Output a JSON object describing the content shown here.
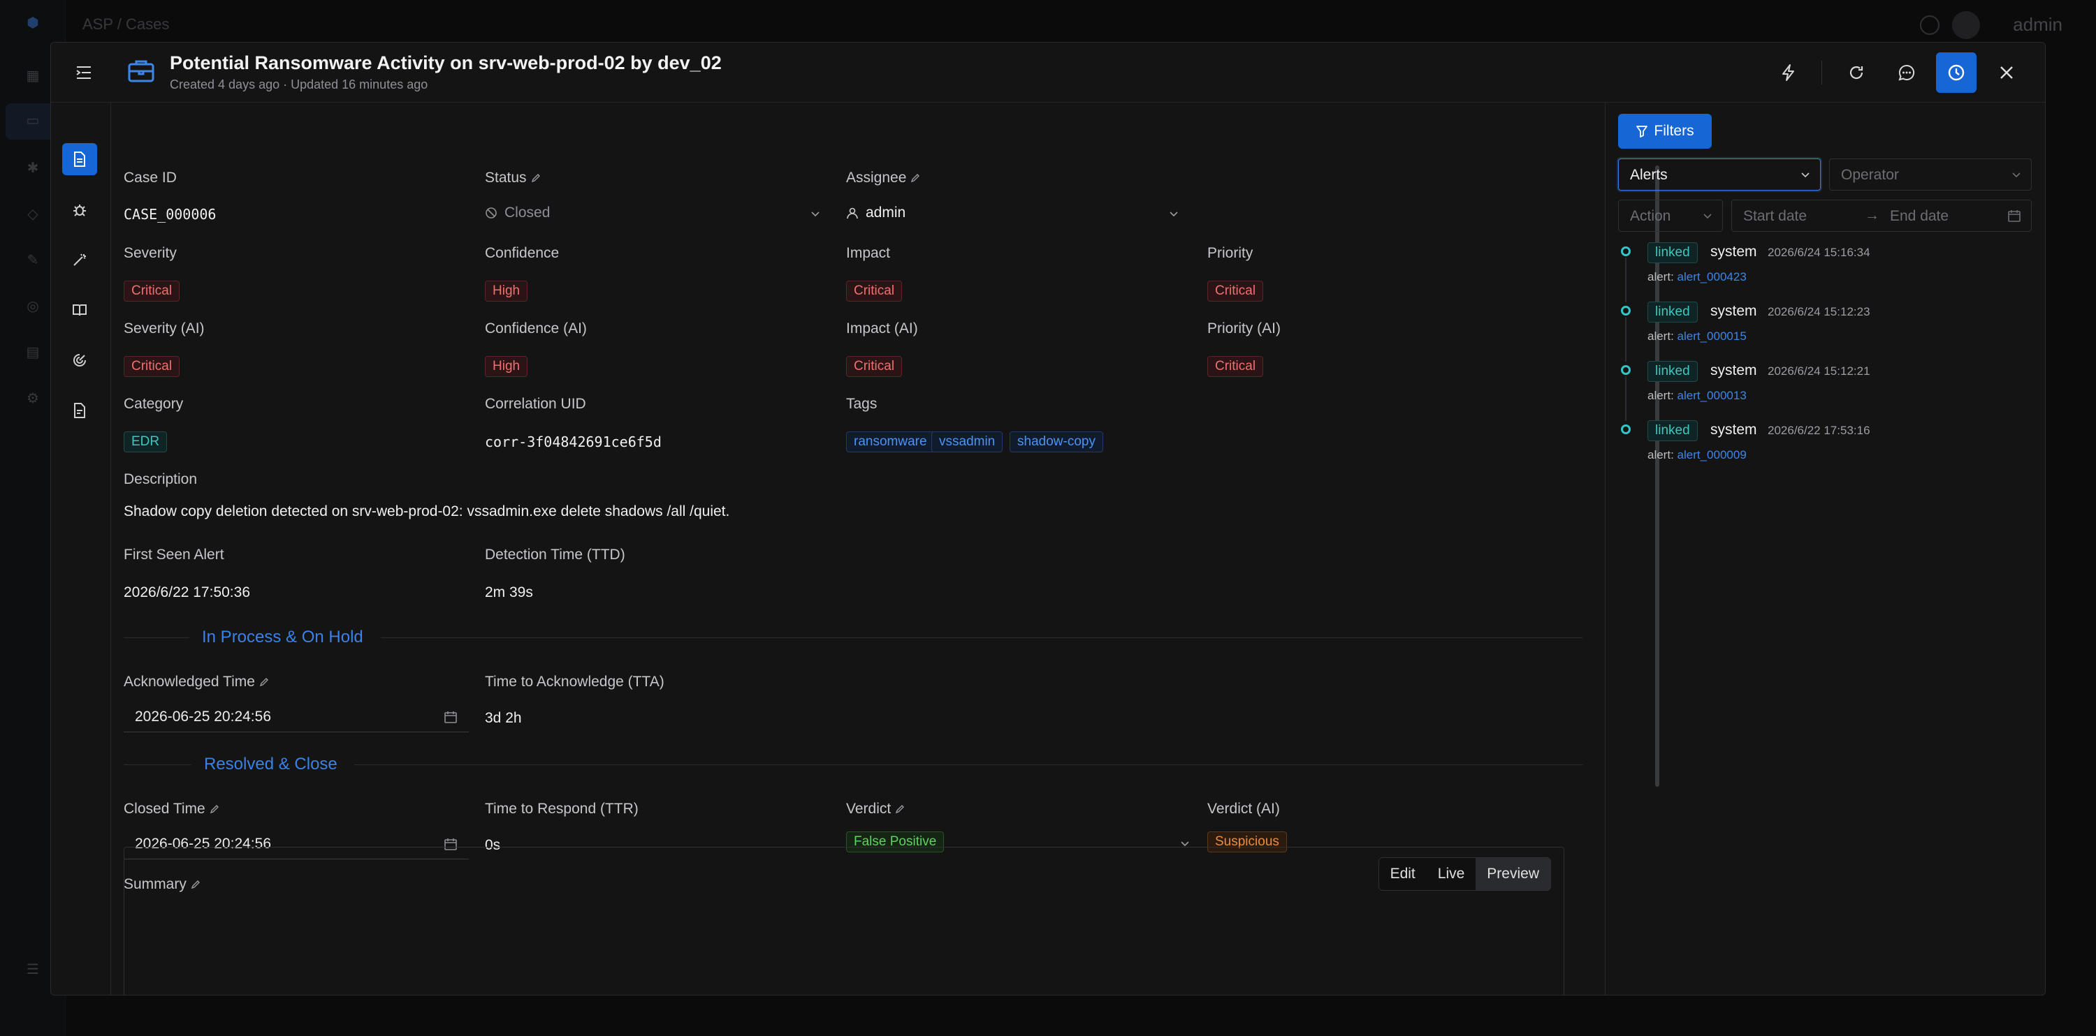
{
  "background": {
    "breadcrumb": "ASP  /  Cases",
    "user": "admin"
  },
  "header": {
    "title": "Potential Ransomware Activity on srv-web-prod-02 by dev_02",
    "subtitle": "Created 4 days ago  ·  Updated 16 minutes ago"
  },
  "fields": {
    "case_id_label": "Case ID",
    "case_id": "CASE_000006",
    "status_label": "Status",
    "status": "Closed",
    "assignee_label": "Assignee",
    "assignee": "admin",
    "severity_label": "Severity",
    "severity": "Critical",
    "confidence_label": "Confidence",
    "confidence": "High",
    "impact_label": "Impact",
    "impact": "Critical",
    "priority_label": "Priority",
    "priority": "Critical",
    "severity_ai_label": "Severity (AI)",
    "severity_ai": "Critical",
    "confidence_ai_label": "Confidence (AI)",
    "confidence_ai": "High",
    "impact_ai_label": "Impact (AI)",
    "impact_ai": "Critical",
    "priority_ai_label": "Priority (AI)",
    "priority_ai": "Critical",
    "category_label": "Category",
    "category": "EDR",
    "correlation_label": "Correlation UID",
    "correlation": "corr-3f04842691ce6f5d",
    "tags_label": "Tags",
    "tags": [
      "ransomware",
      "vssadmin",
      "shadow-copy"
    ],
    "description_label": "Description",
    "description": "Shadow copy deletion detected on srv-web-prod-02: vssadmin.exe delete shadows /all /quiet.",
    "first_seen_label": "First Seen Alert",
    "first_seen": "2026/6/22 17:50:36",
    "ttd_label": "Detection Time (TTD)",
    "ttd": "2m 39s"
  },
  "in_process": {
    "section_title": "In Process & On Hold",
    "ack_label": "Acknowledged Time",
    "ack": "2026-06-25 20:24:56",
    "tta_label": "Time to Acknowledge (TTA)",
    "tta": "3d 2h"
  },
  "resolved": {
    "section_title": "Resolved & Close",
    "closed_label": "Closed Time",
    "closed": "2026-06-25 20:24:56",
    "ttr_label": "Time to Respond (TTR)",
    "ttr": "0s",
    "verdict_label": "Verdict",
    "verdict": "False Positive",
    "verdict_ai_label": "Verdict (AI)",
    "verdict_ai": "Suspicious",
    "summary_label": "Summary"
  },
  "editor_modes": [
    "Edit",
    "Live",
    "Preview"
  ],
  "panel": {
    "filters_label": "Filters",
    "type_select": "Alerts",
    "operator_placeholder": "Operator",
    "action_placeholder": "Action",
    "start_placeholder": "Start date",
    "end_placeholder": "End date",
    "timeline": [
      {
        "badge": "linked",
        "actor": "system",
        "time": "2026/6/24 15:16:34",
        "prefix": "alert:",
        "ref": "alert_000423"
      },
      {
        "badge": "linked",
        "actor": "system",
        "time": "2026/6/24 15:12:23",
        "prefix": "alert:",
        "ref": "alert_000015"
      },
      {
        "badge": "linked",
        "actor": "system",
        "time": "2026/6/24 15:12:21",
        "prefix": "alert:",
        "ref": "alert_000013"
      },
      {
        "badge": "linked",
        "actor": "system",
        "time": "2026/6/22 17:53:16",
        "prefix": "alert:",
        "ref": "alert_000009"
      }
    ]
  },
  "colors": {
    "accent": "#1766d6",
    "critical": "#f07070",
    "teal": "#3fc7c0",
    "link": "#3d86e8"
  }
}
